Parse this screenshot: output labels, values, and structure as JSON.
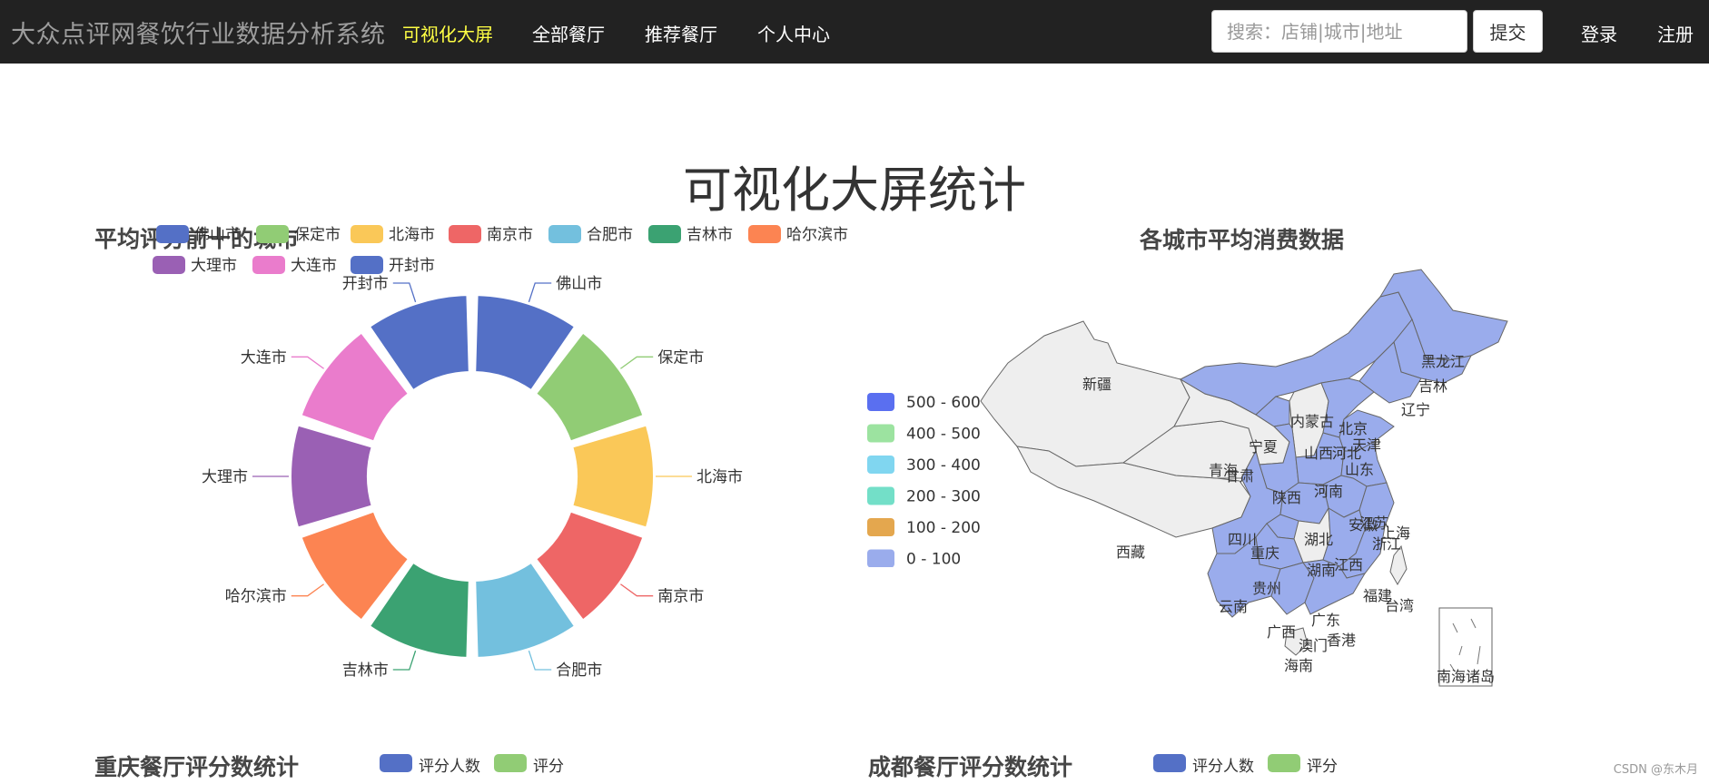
{
  "navbar": {
    "brand": "大众点评网餐饮行业数据分析系统",
    "links": [
      {
        "label": "可视化大屏",
        "active": true
      },
      {
        "label": "全部餐厅",
        "active": false
      },
      {
        "label": "推荐餐厅",
        "active": false
      },
      {
        "label": "个人中心",
        "active": false
      }
    ],
    "search_placeholder": "搜索：店铺|城市|地址",
    "submit_label": "提交",
    "login_label": "登录",
    "register_label": "注册"
  },
  "page_title": "可视化大屏统计",
  "donut": {
    "title": "平均评分前十的城市",
    "legend": [
      "佛山市",
      "保定市",
      "北海市",
      "南京市",
      "合肥市",
      "吉林市",
      "哈尔滨市",
      "大理市",
      "大连市",
      "开封市"
    ],
    "colors": {
      "佛山市": "#5470c6",
      "保定市": "#91cc75",
      "北海市": "#fac858",
      "南京市": "#ee6666",
      "合肥市": "#73c0de",
      "吉林市": "#3ba272",
      "哈尔滨市": "#fc8452",
      "大理市": "#9a60b4",
      "大连市": "#ea7ccc",
      "开封市": "#5470c6"
    }
  },
  "map": {
    "title": "各城市平均消费数据",
    "legend": [
      {
        "label": "500 - 600",
        "color": "#5a6ff0"
      },
      {
        "label": "400 - 500",
        "color": "#9ce3a0"
      },
      {
        "label": "300 - 400",
        "color": "#80d6f0"
      },
      {
        "label": "200 - 300",
        "color": "#73dfc8"
      },
      {
        "label": "100 - 200",
        "color": "#e4a74e"
      },
      {
        "label": "0 - 100",
        "color": "#9aacec"
      }
    ],
    "provinces": [
      "新疆",
      "西藏",
      "青海",
      "甘肃",
      "宁夏",
      "内蒙古",
      "黑龙江",
      "吉林",
      "辽宁",
      "北京",
      "天津",
      "河北",
      "山西",
      "山东",
      "陕西",
      "河南",
      "江苏",
      "安徽",
      "上海",
      "四川",
      "重庆",
      "湖北",
      "浙江",
      "湖南",
      "江西",
      "贵州",
      "云南",
      "福建",
      "台湾",
      "广西",
      "广东",
      "澳门",
      "香港",
      "海南",
      "南海诸岛"
    ]
  },
  "bottom": {
    "chongqing_title": "重庆餐厅评分数统计",
    "chengdu_title": "成都餐厅评分数统计",
    "series": [
      "评分人数",
      "评分"
    ]
  },
  "watermark": "CSDN @东木月"
}
